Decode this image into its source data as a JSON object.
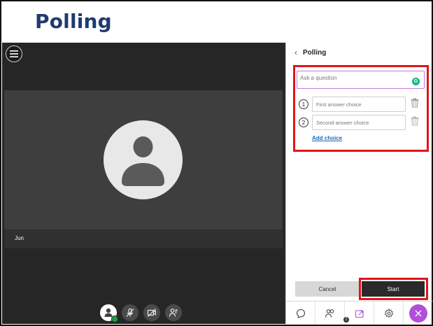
{
  "slide": {
    "title": "Polling"
  },
  "stage": {
    "participant_name": "Jun"
  },
  "panel": {
    "title": "Polling",
    "question_placeholder": "Ask a question",
    "choices": [
      {
        "number": "1",
        "placeholder": "First answer choice"
      },
      {
        "number": "2",
        "placeholder": "Second answer choice"
      }
    ],
    "add_choice_label": "Add choice",
    "cancel_label": "Cancel",
    "start_label": "Start",
    "participants_count": "2"
  },
  "icons": {
    "menu": "hamburger-menu-icon",
    "back": "chevron-left-icon",
    "grammar": "grammarly-icon",
    "trash": "trash-icon",
    "chat": "chat-icon",
    "attendees": "attendees-icon",
    "share": "share-content-icon",
    "settings": "gear-icon",
    "close": "close-icon",
    "mic_off": "microphone-off-icon",
    "camera_off": "camera-off-icon",
    "hand": "raise-hand-icon"
  },
  "colors": {
    "title": "#1f3b6e",
    "highlight": "#e0141b",
    "accent": "#b04fd9",
    "link": "#1b6bb5",
    "status": "#1e9e4a"
  }
}
